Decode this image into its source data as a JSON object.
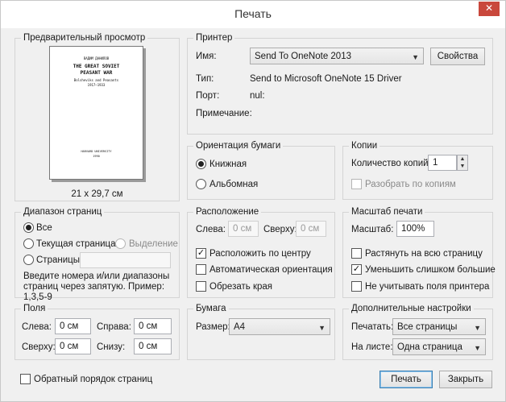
{
  "window": {
    "title": "Печать",
    "close_icon": "close-icon"
  },
  "preview": {
    "title": "Предварительный просмотр",
    "paper_size": "21 x 29,7 см",
    "doc_author": "ВАДИМ ДАНИЛОВ",
    "doc_title_1": "THE GREAT SOVIET",
    "doc_title_2": "PEASANT WAR",
    "doc_subtitle": "Bolsheviks and Peasants",
    "doc_years": "1917–1933",
    "doc_publisher": "HARVARD UNIVERSITY",
    "doc_year": "1990"
  },
  "printer": {
    "title": "Принтер",
    "name_label": "Имя:",
    "name_value": "Send To OneNote 2013",
    "properties_button": "Свойства",
    "type_label": "Тип:",
    "type_value": "Send to Microsoft OneNote 15 Driver",
    "port_label": "Порт:",
    "port_value": "nul:",
    "note_label": "Примечание:"
  },
  "orientation": {
    "title": "Ориентация бумаги",
    "portrait": "Книжная",
    "landscape": "Альбомная"
  },
  "copies": {
    "title": "Копии",
    "count_label": "Количество копий:",
    "count_value": "1",
    "collate": "Разобрать по копиям"
  },
  "page_range": {
    "title": "Диапазон страниц",
    "all": "Все",
    "current": "Текущая страница",
    "selection": "Выделение",
    "pages": "Страницы:",
    "pages_value": "",
    "hint": "Введите номера и/или диапазоны страниц через запятую. Пример: 1,3,5-9"
  },
  "placement": {
    "title": "Расположение",
    "left_label": "Слева:",
    "left_value": "0 см",
    "top_label": "Сверху:",
    "top_value": "0 см",
    "center": "Расположить по центру",
    "auto_orient": "Автоматическая ориентация",
    "crop": "Обрезать края"
  },
  "scale": {
    "title": "Масштаб печати",
    "scale_label": "Масштаб:",
    "scale_value": "100%",
    "stretch": "Растянуть на всю страницу",
    "shrink": "Уменьшить слишком большие",
    "ignore_margins": "Не учитывать поля принтера"
  },
  "margins": {
    "title": "Поля",
    "left_label": "Слева:",
    "left_value": "0 см",
    "right_label": "Справа:",
    "right_value": "0 см",
    "top_label": "Сверху:",
    "top_value": "0 см",
    "bottom_label": "Снизу:",
    "bottom_value": "0 см"
  },
  "paper": {
    "title": "Бумага",
    "size_label": "Размер:",
    "size_value": "A4"
  },
  "advanced": {
    "title": "Дополнительные настройки",
    "print_label": "Печатать:",
    "print_value": "Все страницы",
    "sheet_label": "На листе:",
    "sheet_value": "Одна страница"
  },
  "footer": {
    "reverse_order": "Обратный порядок страниц",
    "print_button": "Печать",
    "close_button": "Закрыть"
  }
}
